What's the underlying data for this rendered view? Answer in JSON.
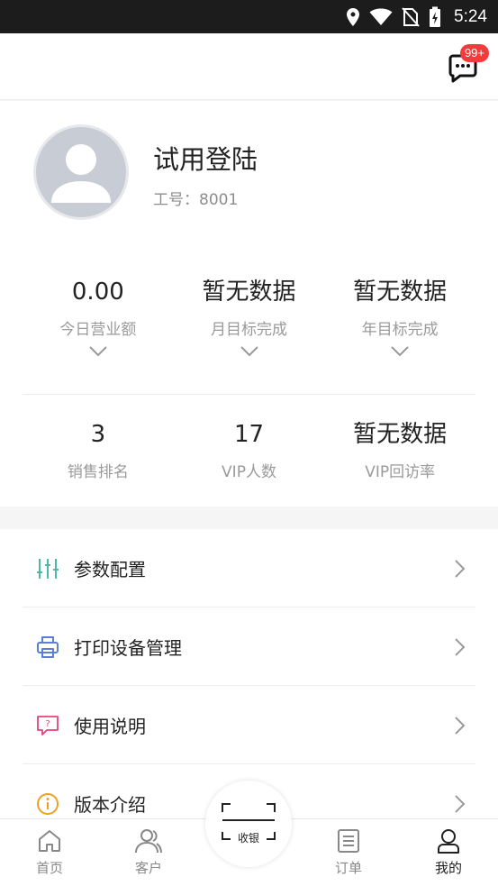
{
  "status_bar": {
    "time": "5:24"
  },
  "header": {
    "message_badge": "99+"
  },
  "profile": {
    "name": "试用登陆",
    "employee_id": "工号：8001"
  },
  "stats_top": [
    {
      "value": "0.00",
      "label": "今日营业额"
    },
    {
      "value": "暂无数据",
      "label": "月目标完成"
    },
    {
      "value": "暂无数据",
      "label": "年目标完成"
    }
  ],
  "stats_bottom": [
    {
      "value": "3",
      "label": "销售排名"
    },
    {
      "value": "17",
      "label": "VIP人数"
    },
    {
      "value": "暂无数据",
      "label": "VIP回访率"
    }
  ],
  "menu": [
    {
      "label": "参数配置",
      "icon": "settings-sliders-icon",
      "color": "#4cb8a8"
    },
    {
      "label": "打印设备管理",
      "icon": "printer-icon",
      "color": "#5b7fd6"
    },
    {
      "label": "使用说明",
      "icon": "help-chat-icon",
      "color": "#e0457b"
    },
    {
      "label": "版本介绍",
      "icon": "info-icon",
      "color": "#f0a020"
    }
  ],
  "tabbar": {
    "home": "首页",
    "customers": "客户",
    "cashier": "收银",
    "orders": "订单",
    "mine": "我的"
  }
}
